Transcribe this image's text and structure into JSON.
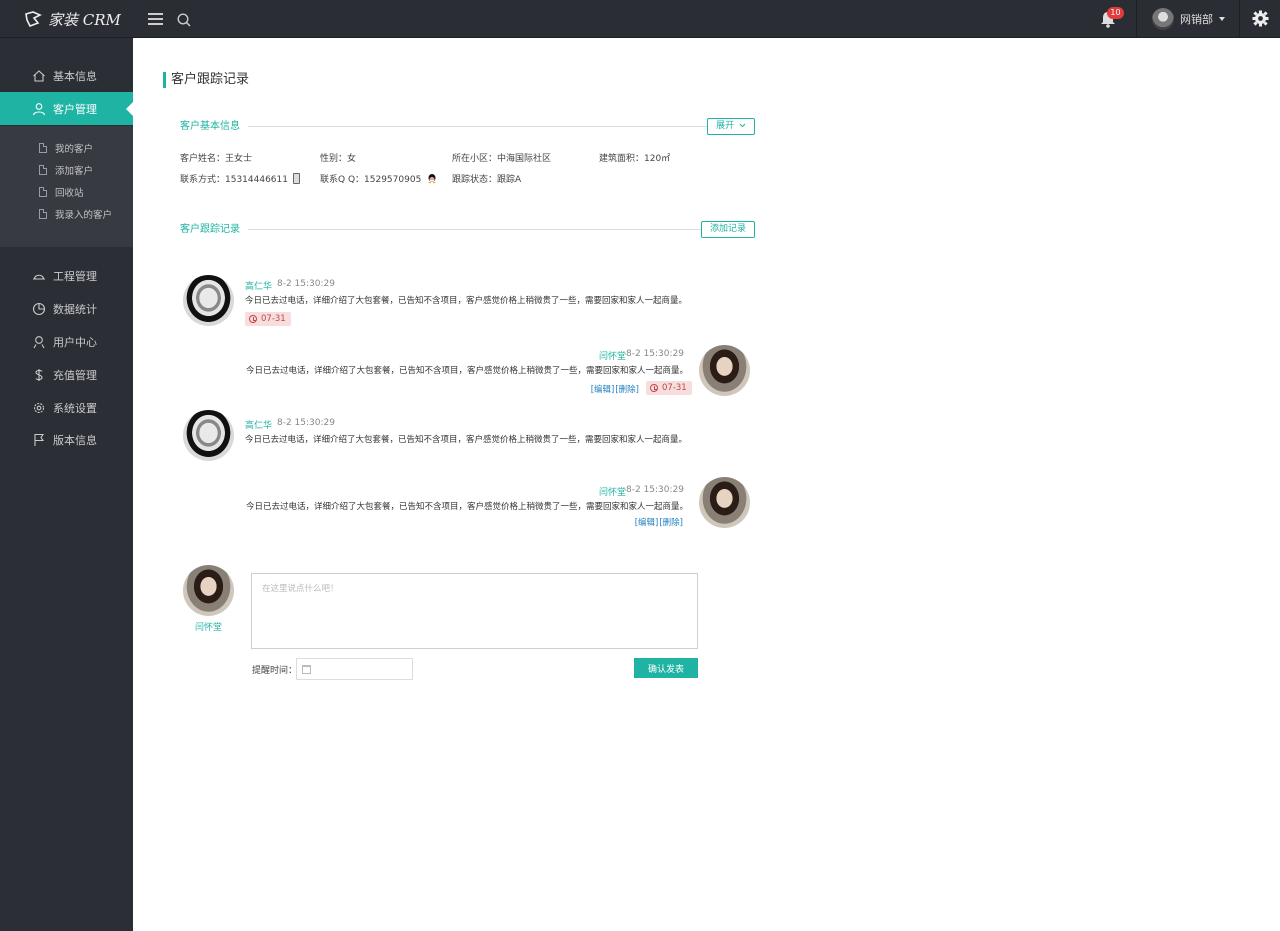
{
  "header": {
    "logo_text": "家装 CRM",
    "notification_count": "10",
    "user_name": "网销部"
  },
  "sidebar": {
    "items": [
      {
        "label": "基本信息",
        "icon": "home-icon"
      },
      {
        "label": "客户管理",
        "icon": "user-icon",
        "active": true
      },
      {
        "label": "工程管理",
        "icon": "helmet-icon"
      },
      {
        "label": "数据统计",
        "icon": "pie-chart-icon"
      },
      {
        "label": "用户中心",
        "icon": "user-center-icon"
      },
      {
        "label": "充值管理",
        "icon": "dollar-icon"
      },
      {
        "label": "系统设置",
        "icon": "gear-icon"
      },
      {
        "label": "版本信息",
        "icon": "flag-icon"
      }
    ],
    "submenu": [
      "我的客户",
      "添加客户",
      "回收站",
      "我录入的客户"
    ]
  },
  "main": {
    "title": "客户跟踪记录",
    "basic_info": {
      "heading": "客户基本信息",
      "expand_label": "展开",
      "name": "客户姓名：王女士",
      "gender": "性别：女",
      "community": "所在小区：中海国际社区",
      "area": "建筑面积：120㎡",
      "phone": "联系方式：15314446611",
      "qq": "联系Q Q：1529570905",
      "status": "跟踪状态：跟踪A"
    },
    "records_heading": "客户跟踪记录",
    "add_record_label": "添加记录",
    "records": [
      {
        "name": "高仁华",
        "time": "8-2 15:30:29",
        "text": "今日已去过电话，详细介绍了大包套餐，已告知不含项目，客户感觉价格上稍微贵了一些，需要回家和家人一起商量。",
        "date": "07-31"
      },
      {
        "name": "闫怀堂",
        "time": "8-2 15:30:29",
        "text": "今日已去过电话，详细介绍了大包套餐，已告知不含项目，客户感觉价格上稍微贵了一些，需要回家和家人一起商量。",
        "edit": "[编辑]",
        "delete": "[删除]",
        "date": "07-31"
      },
      {
        "name": "高仁华",
        "time": "8-2 15:30:29",
        "text": "今日已去过电话，详细介绍了大包套餐，已告知不含项目，客户感觉价格上稍微贵了一些，需要回家和家人一起商量。"
      },
      {
        "name": "闫怀堂",
        "time": "8-2 15:30:29",
        "text": "今日已去过电话，详细介绍了大包套餐，已告知不含项目，客户感觉价格上稍微贵了一些，需要回家和家人一起商量。",
        "edit": "[编辑]",
        "delete": "[删除]"
      }
    ],
    "composer": {
      "user_name": "闫怀堂",
      "placeholder": "在这里说点什么吧！",
      "remind_label": "提醒时间：",
      "submit_label": "确认发表"
    }
  },
  "colors": {
    "accent": "#1fb3a3",
    "topbar": "#2b2d34",
    "sidebar": "#2c2e35",
    "date_tag_bg": "#f7dede",
    "link": "#1f7fc0"
  }
}
